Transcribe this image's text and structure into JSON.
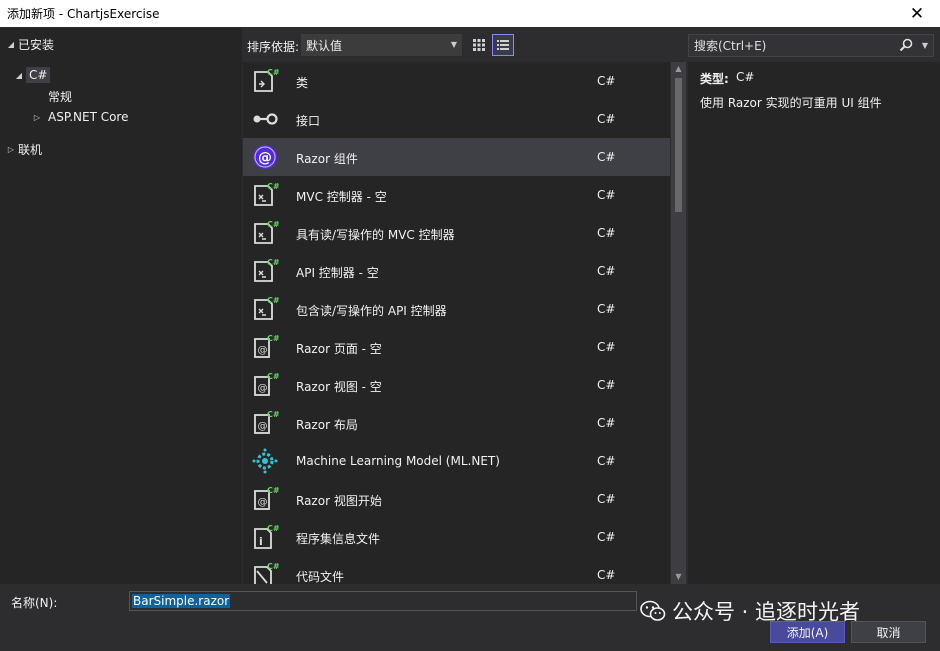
{
  "window": {
    "title": "添加新项 - ChartjsExercise",
    "close_glyph": "✕"
  },
  "tree": {
    "installed": "已安装",
    "csharp": "C#",
    "general": "常规",
    "aspnet_core": "ASP.NET Core",
    "online": "联机"
  },
  "toolbar": {
    "sort_label": "排序依据:",
    "sort_value": "默认值",
    "search_placeholder": "搜索(Ctrl+E)"
  },
  "templates": [
    {
      "name": "类",
      "lang": "C#",
      "icon": "csharp-class-icon"
    },
    {
      "name": "接口",
      "lang": "C#",
      "icon": "interface-icon"
    },
    {
      "name": "Razor 组件",
      "lang": "C#",
      "icon": "blazor-icon"
    },
    {
      "name": "MVC 控制器 - 空",
      "lang": "C#",
      "icon": "controller-icon"
    },
    {
      "name": "具有读/写操作的 MVC 控制器",
      "lang": "C#",
      "icon": "controller-icon"
    },
    {
      "name": "API 控制器 - 空",
      "lang": "C#",
      "icon": "controller-icon"
    },
    {
      "name": "包含读/写操作的 API 控制器",
      "lang": "C#",
      "icon": "controller-icon"
    },
    {
      "name": "Razor 页面 - 空",
      "lang": "C#",
      "icon": "razor-page-icon"
    },
    {
      "name": "Razor 视图 - 空",
      "lang": "C#",
      "icon": "razor-page-icon"
    },
    {
      "name": "Razor 布局",
      "lang": "C#",
      "icon": "razor-page-icon"
    },
    {
      "name": "Machine Learning Model (ML.NET)",
      "lang": "C#",
      "icon": "mlnet-gear-icon"
    },
    {
      "name": "Razor 视图开始",
      "lang": "C#",
      "icon": "razor-page-icon"
    },
    {
      "name": "程序集信息文件",
      "lang": "C#",
      "icon": "assembly-info-icon"
    },
    {
      "name": "代码文件",
      "lang": "C#",
      "icon": "code-file-icon"
    }
  ],
  "details": {
    "type_label": "类型:",
    "type_value": "C#",
    "description": "使用 Razor 实现的可重用 UI 组件"
  },
  "bottom": {
    "name_label": "名称(N):",
    "name_value": "BarSimple.razor",
    "add_label": "添加(A)",
    "cancel_label": "取消"
  },
  "watermark": {
    "text": "公众号 · 追逐时光者"
  },
  "colors": {
    "accent": "#7f8cff",
    "csharp_green": "#6fd26f",
    "blazor_purple": "#512bd4",
    "ml_cyan": "#2ec4d6"
  }
}
